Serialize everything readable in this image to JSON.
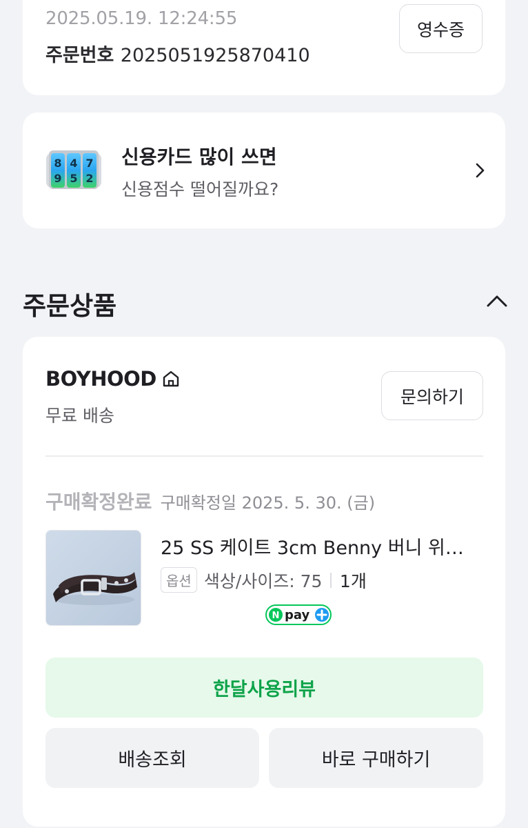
{
  "order": {
    "datetime": "2025.05.19. 12:24:55",
    "number_label": "주문번호",
    "number": "2025051925870410",
    "receipt_label": "영수증"
  },
  "promo": {
    "title": "신용카드 많이 쓰면",
    "subtitle": "신용점수 떨어질까요?",
    "icon": "number-lock-dial-icon",
    "digits_top": [
      "8",
      "4",
      "7"
    ],
    "digits_bottom": [
      "9",
      "5",
      "2"
    ]
  },
  "section": {
    "title": "주문상품"
  },
  "product_card": {
    "store_name": "BOYHOOD",
    "shipping": "무료 배송",
    "inquiry_label": "문의하기",
    "status": "구매확정완료",
    "status_date": "구매확정일 2025. 5. 30. (금)",
    "item": {
      "name": "25 SS 케이트 3cm Benny 버니 위…",
      "option_badge": "옵션",
      "option_value": "색상/사이즈: 75",
      "quantity": "1개",
      "pay_badge": "pay"
    },
    "review_label": "한달사용리뷰",
    "track_label": "배송조회",
    "buy_again_label": "바로 구매하기"
  },
  "colors": {
    "background": "#f2f3f6",
    "card": "#ffffff",
    "review_bg": "#e6f9ea",
    "review_text": "#0ea34a",
    "npay_green": "#03c75a"
  }
}
